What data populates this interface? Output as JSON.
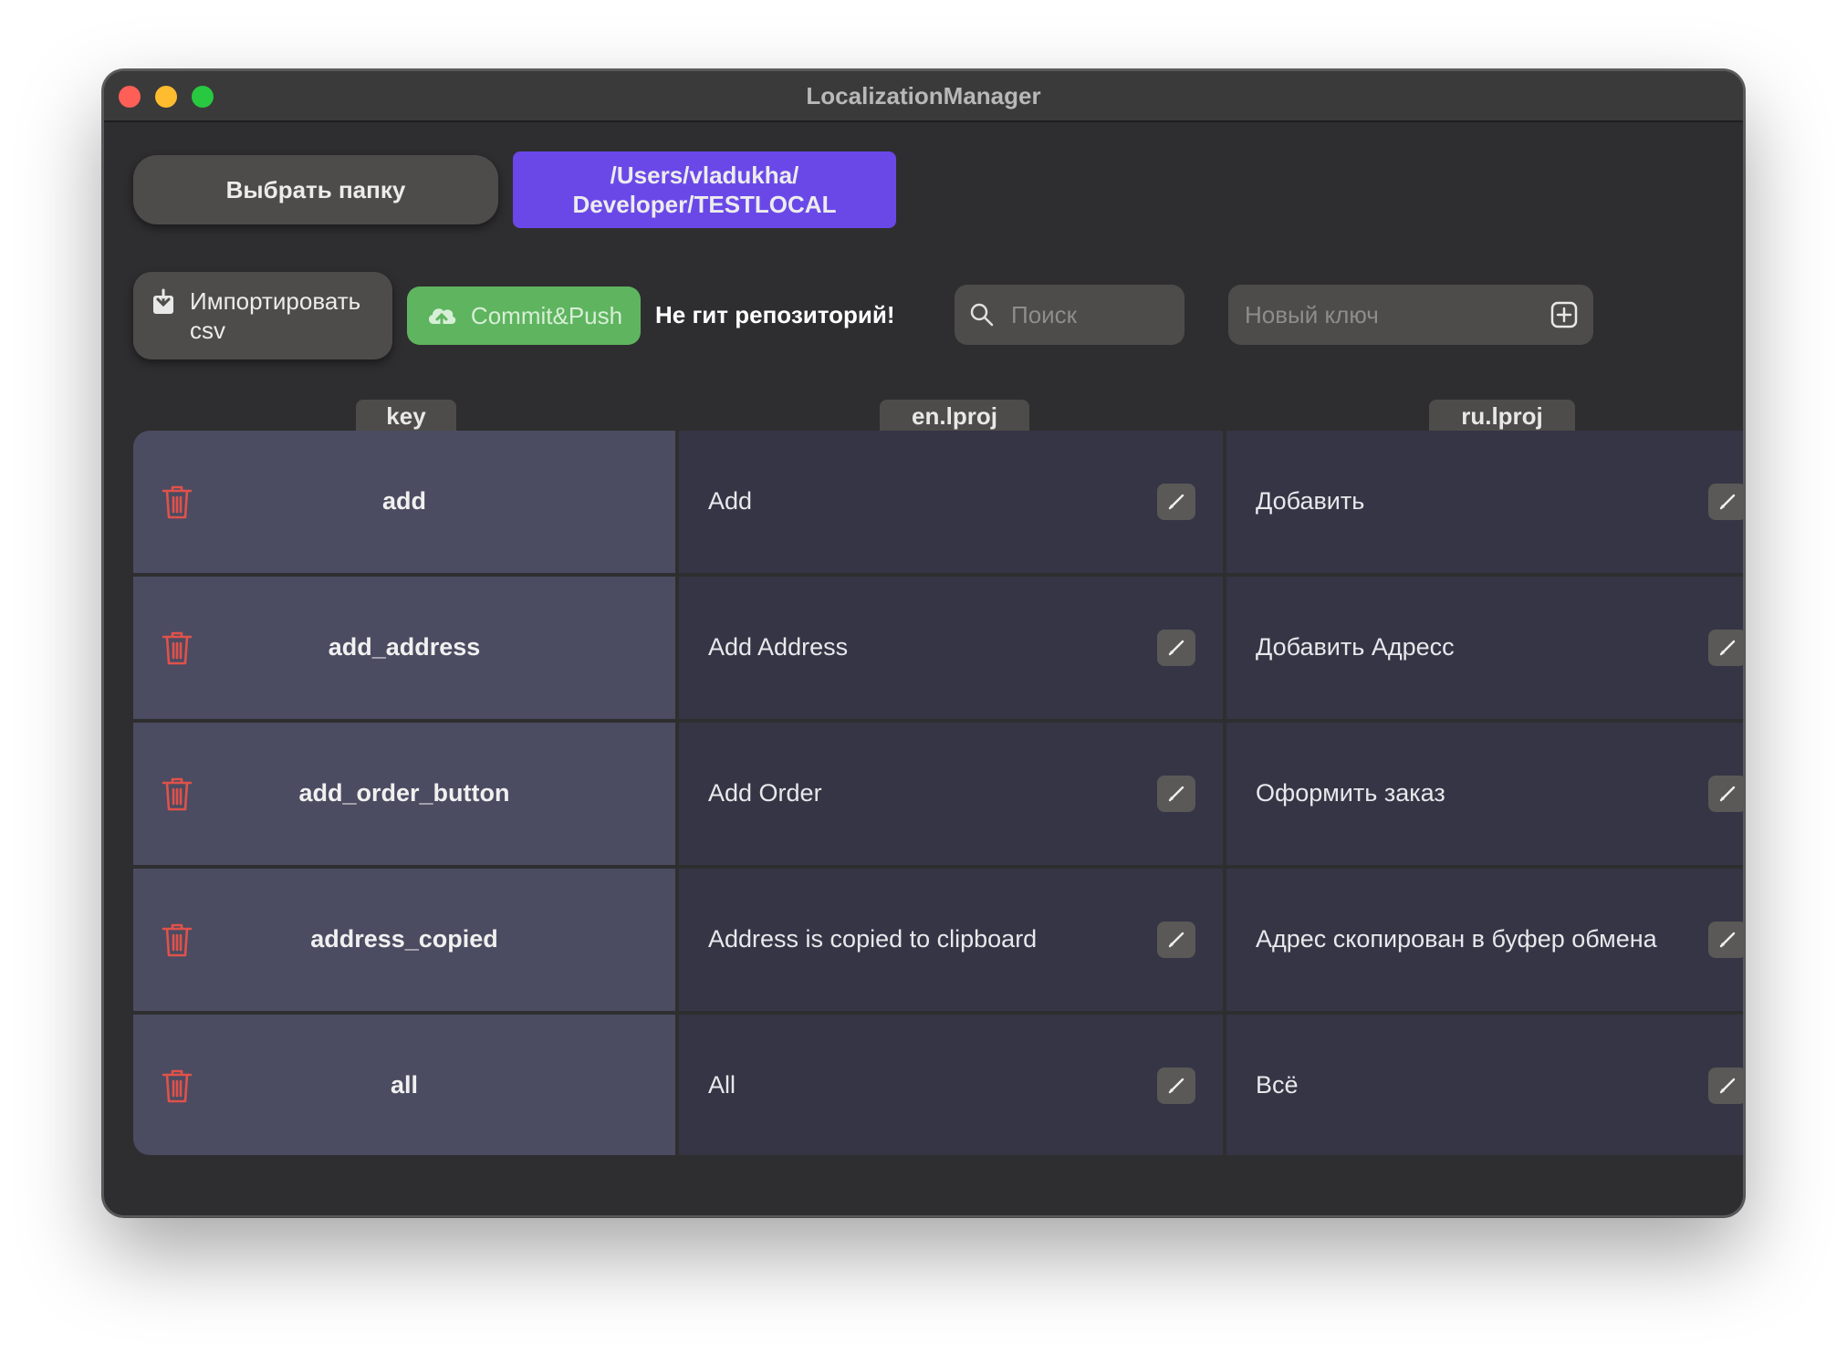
{
  "window": {
    "title": "LocalizationManager"
  },
  "toolbar": {
    "choose_folder_label": "Выбрать папку",
    "folder_path": "/Users/vladukha/\nDeveloper/TESTLOCAL",
    "import_csv_label": "Импортировать csv",
    "commit_push_label": "Commit&Push",
    "status_text": "Не гит репозиторий!",
    "search": {
      "placeholder": "Поиск",
      "value": ""
    },
    "new_key": {
      "placeholder": "Новый ключ",
      "value": ""
    }
  },
  "columns": [
    "key",
    "en.lproj",
    "ru.lproj"
  ],
  "rows": [
    {
      "key": "add",
      "en": "Add",
      "ru": "Добавить"
    },
    {
      "key": "add_address",
      "en": "Add Address",
      "ru": "Добавить Адресс"
    },
    {
      "key": "add_order_button",
      "en": "Add Order",
      "ru": "Оформить заказ"
    },
    {
      "key": "address_copied",
      "en": "Address is copied to clipboard",
      "ru": "Адрес скопирован в буфер обмена"
    },
    {
      "key": "all",
      "en": "All",
      "ru": "Всё"
    }
  ],
  "colors": {
    "accent_purple": "#6a48e8",
    "commit_green": "#5fb45f",
    "trash_red": "#e0524a",
    "key_cell": "#4b4b61",
    "value_cell": "#353545"
  },
  "icons": [
    "close-icon",
    "minimize-icon",
    "zoom-icon",
    "import-icon",
    "cloud-upload-icon",
    "search-icon",
    "add-square-icon",
    "trash-icon",
    "pencil-icon"
  ]
}
